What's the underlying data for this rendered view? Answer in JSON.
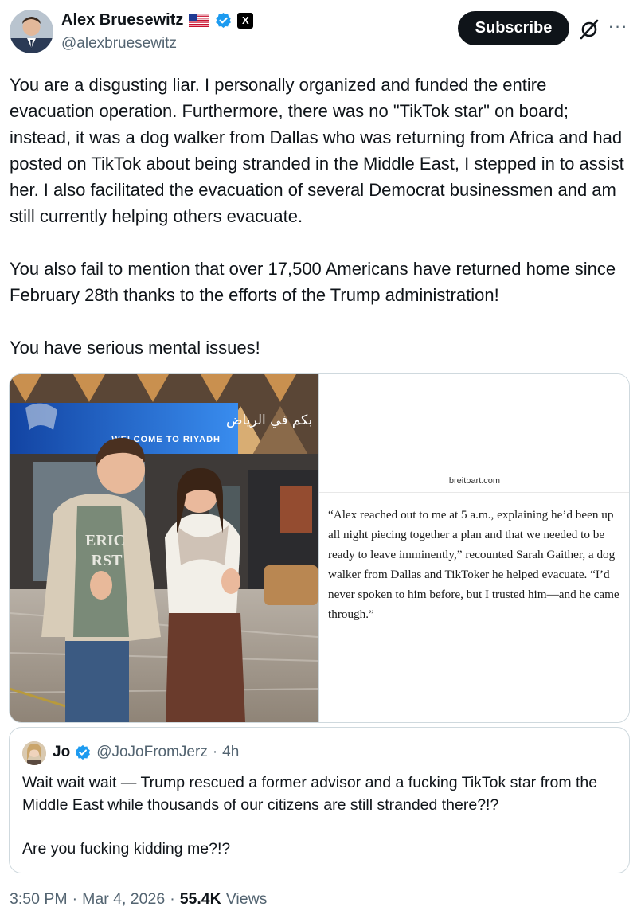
{
  "author": {
    "name": "Alex Bruesewitz",
    "handle": "@alexbruesewitz",
    "flag_icon": "us-flag-icon",
    "verified_icon": "verified-badge-icon",
    "affiliate_badge": "X"
  },
  "actions": {
    "subscribe_label": "Subscribe",
    "grok_icon": "grok-icon",
    "more_icon": "more-icon",
    "more_glyph": "···"
  },
  "tweet": {
    "paragraphs": [
      "You are a disgusting liar. I personally organized and funded the entire evacuation operation. Furthermore, there was no \"TikTok star\" on board; instead, it was a dog walker from Dallas who was returning from Africa and had posted on TikTok about being stranded in the Middle East, I stepped in to assist her. I also facilitated the evacuation of several Democrat businessmen and am still currently helping others evacuate.",
      "You also fail to mention that over 17,500 Americans have returned home since February 28th thanks to the efforts of the Trump administration!",
      "You have serious mental issues!"
    ]
  },
  "media": {
    "photo": {
      "sign_arabic": "مرحبا بكم في الرياض",
      "sign_english": "WELCOME TO RIYADH",
      "shirt_text_line1": "ERIC",
      "shirt_text_line2": "RST"
    },
    "article": {
      "source": "breitbart.com",
      "quote": "“Alex reached out to me at 5 a.m., explaining he’d been up all night piecing together a plan and that we needed to be ready to leave imminently,” recounted Sarah Gaither, a dog walker from Dallas and TikToker he helped evacuate. “I’d never spoken to him before, but I trusted him—and he came through.”"
    }
  },
  "quoted": {
    "name": "Jo",
    "handle": "@JoJoFromJerz",
    "separator": "·",
    "time": "4h",
    "paragraphs": [
      "Wait wait wait — Trump rescued a former advisor and a fucking TikTok star from the Middle East while thousands of our citizens are still stranded there?!?",
      "Are you fucking kidding me?!?"
    ]
  },
  "meta": {
    "time": "3:50 PM",
    "dot1": "·",
    "date": "Mar 4, 2026",
    "dot2": "·",
    "views_count": "55.4K",
    "views_label": "Views"
  },
  "colors": {
    "text": "#0f1419",
    "secondary": "#536471",
    "verified_blue": "#1d9bf0",
    "border": "#cfd9de"
  }
}
